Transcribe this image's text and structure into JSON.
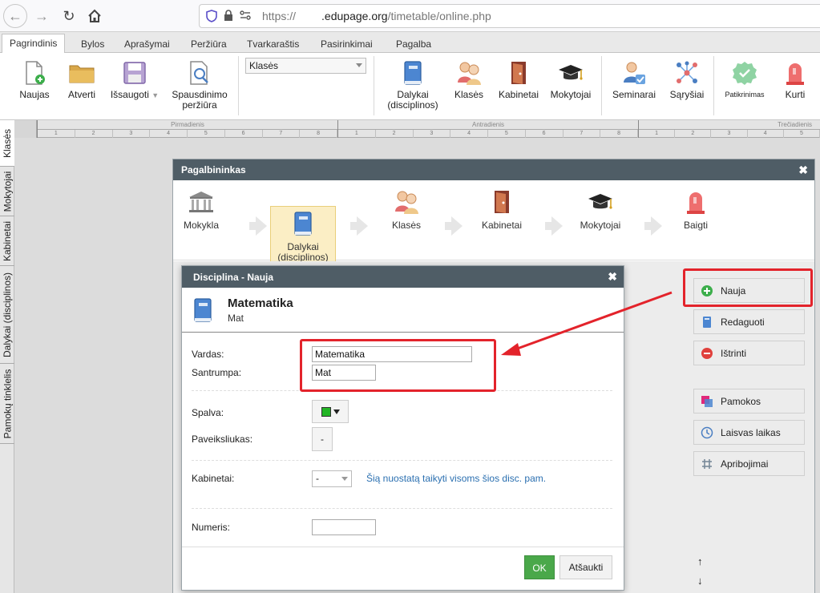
{
  "browser": {
    "url_scheme": "https://",
    "url_host": ".edupage.org",
    "url_path": "/timetable/online.php"
  },
  "menu": {
    "tabs": [
      "Pagrindinis",
      "Bylos",
      "Aprašymai",
      "Peržiūra",
      "Tvarkaraštis",
      "Pasirinkimai",
      "Pagalba"
    ],
    "active": "Pagrindinis"
  },
  "ribbon": {
    "new": "Naujas",
    "open": "Atverti",
    "save": "Išsaugoti",
    "print_line1": "Spausdinimo",
    "print_line2": "peržiūra",
    "class_select": "Klasės",
    "subjects_line1": "Dalykai",
    "subjects_line2": "(disciplinos)",
    "classes": "Klasės",
    "rooms": "Kabinetai",
    "teachers": "Mokytojai",
    "seminars": "Seminarai",
    "relations": "Sąryšiai",
    "check": "Patikrinimas",
    "create": "Kurti"
  },
  "vtabs": [
    "Klasės",
    "Mokytojai",
    "Kabinetai",
    "Dalykai (disciplinos)",
    "Pamokų tinklelis"
  ],
  "timetable": {
    "days": [
      "Pirmadienis",
      "Antradienis",
      "Trečiadienis"
    ],
    "periods": [
      "1",
      "2",
      "3",
      "4",
      "5",
      "6",
      "7",
      "8"
    ],
    "partial_periods": [
      "1",
      "2",
      "3",
      "4",
      "5"
    ]
  },
  "wizard": {
    "title": "Pagalbininkas",
    "steps": {
      "school": "Mokykla",
      "subjects_line1": "Dalykai",
      "subjects_line2": "(disciplinos)",
      "classes": "Klasės",
      "rooms": "Kabinetai",
      "teachers": "Mokytojai",
      "finish": "Baigti"
    },
    "side_buttons": {
      "new": "Nauja",
      "edit": "Redaguoti",
      "delete": "Ištrinti",
      "lessons": "Pamokos",
      "free_time": "Laisvas laikas",
      "constraints": "Apribojimai"
    },
    "up": "↑",
    "down": "↓"
  },
  "dialog": {
    "title": "Disciplina - Nauja",
    "subject_name": "Matematika",
    "subject_short": "Mat",
    "name_label": "Vardas:",
    "name_value": "Matematika",
    "short_label": "Santrumpa:",
    "short_value": "Mat",
    "color_label": "Spalva:",
    "picture_label": "Paveiksliukas:",
    "picture_value": "-",
    "rooms_label": "Kabinetai:",
    "rooms_value": "-",
    "rooms_link": "Šią nuostatą taikyti visoms šios disc. pam.",
    "number_label": "Numeris:",
    "number_value": "",
    "ok": "OK",
    "cancel": "Atšaukti"
  },
  "colors": {
    "title_bar": "#4f5d66",
    "ok_green": "#4aa84a",
    "subject_color": "#22b525",
    "annotation_red": "#e3232b",
    "link_blue": "#2a6fb0"
  }
}
